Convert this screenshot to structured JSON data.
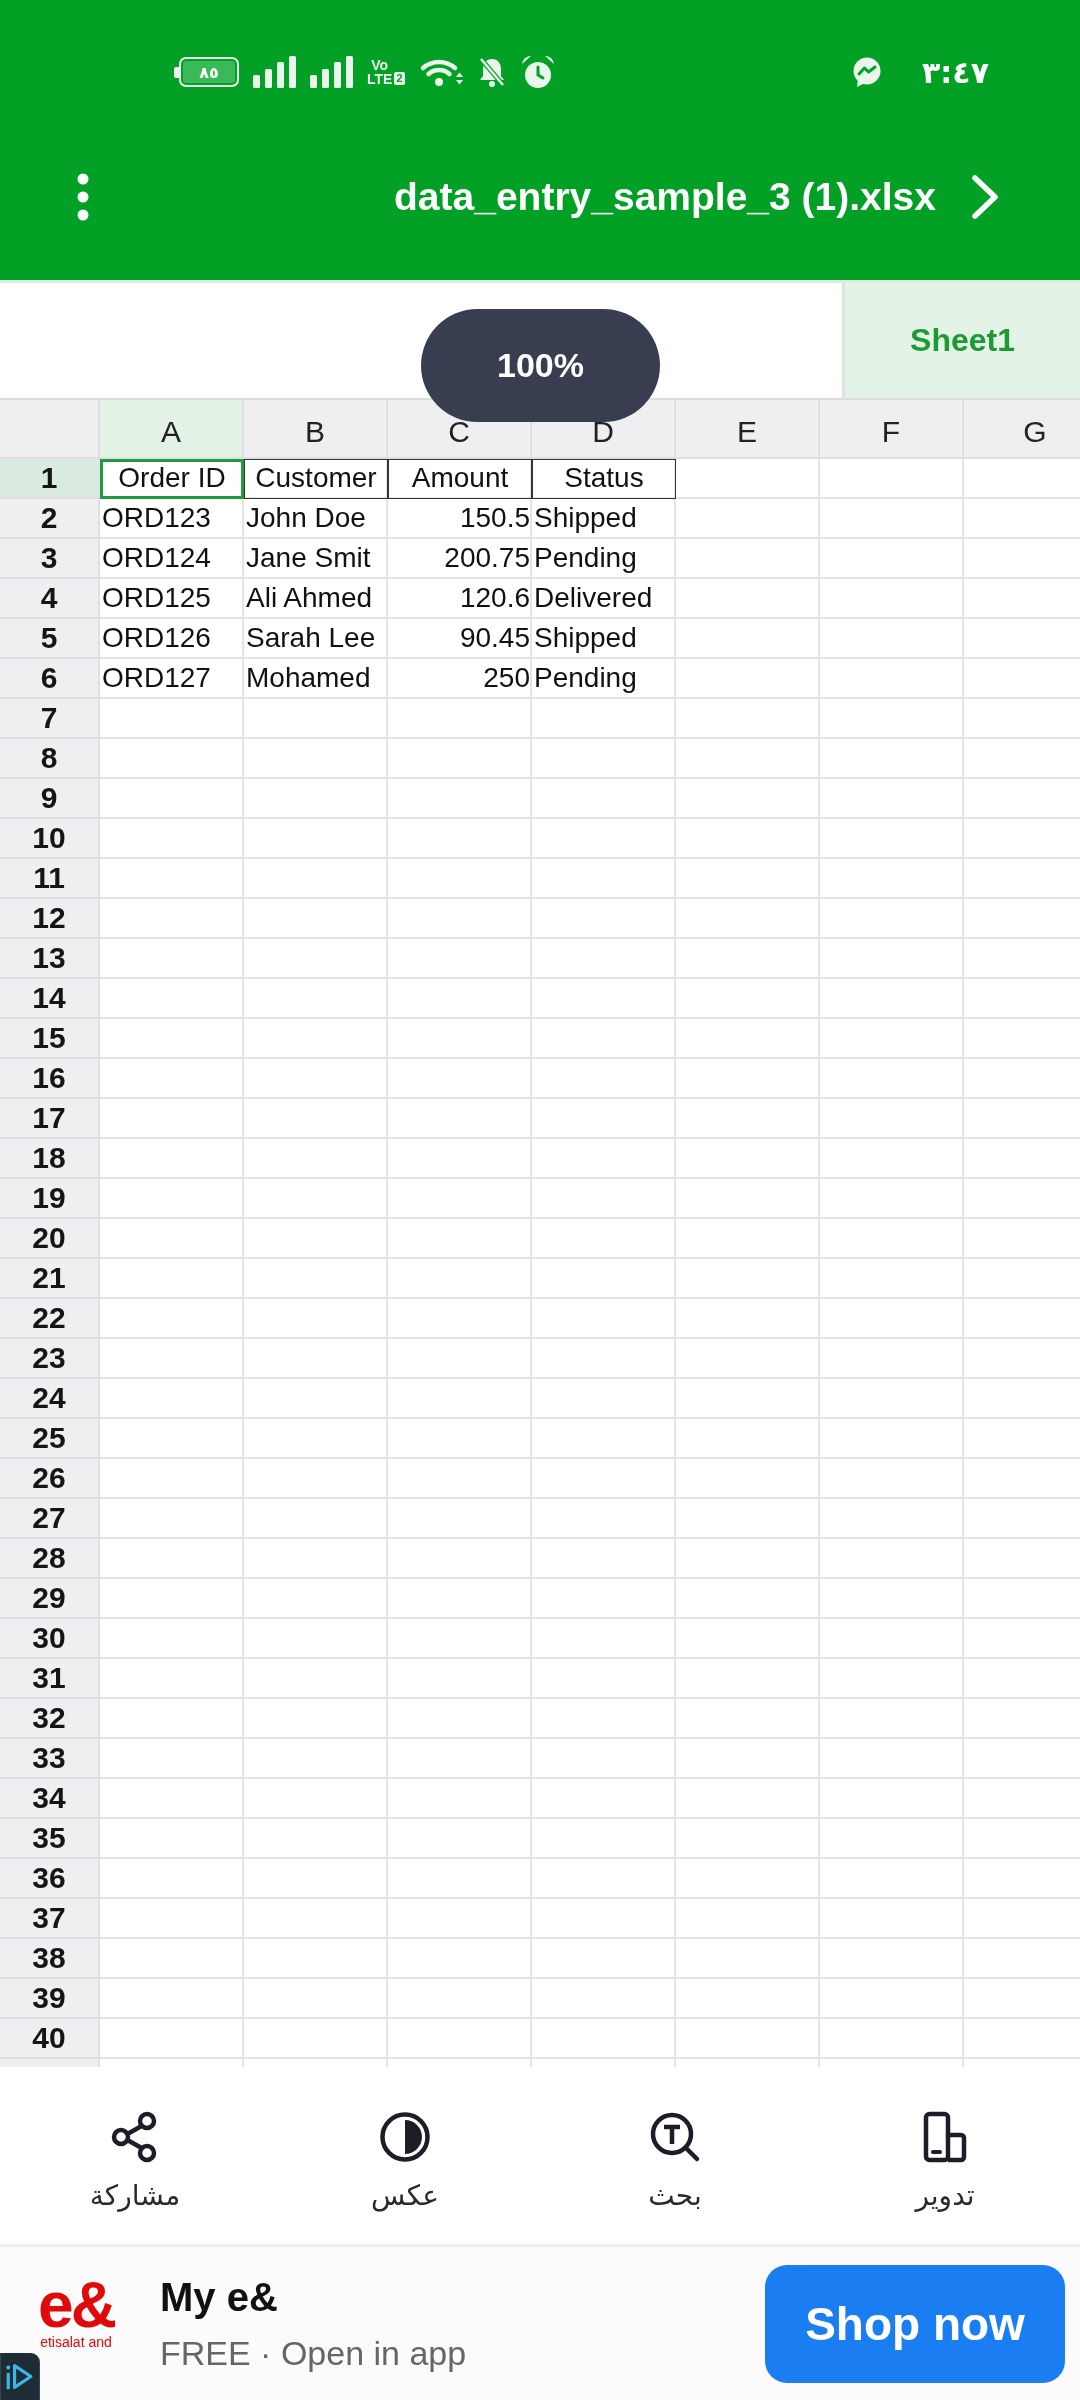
{
  "status_bar": {
    "battery": "٨٥",
    "network_type": "Vo LTE",
    "sim": "2",
    "time": "٣:٤٧"
  },
  "title_bar": {
    "title": "data_entry_sample_3 (1).xlsx"
  },
  "zoom_badge": "100%",
  "sheet_tabs": [
    {
      "label": "Sheet1",
      "selected": true
    }
  ],
  "sheet": {
    "columns": [
      {
        "label": "A",
        "selected": true
      },
      {
        "label": "B",
        "selected": false
      },
      {
        "label": "C",
        "selected": false
      },
      {
        "label": "D",
        "selected": false
      },
      {
        "label": "E",
        "selected": false
      },
      {
        "label": "F",
        "selected": false
      },
      {
        "label": "G",
        "selected": false
      }
    ],
    "rows": [
      {
        "number": "1",
        "selected": true,
        "cells": [
          {
            "text": "Order ID",
            "kind": "header",
            "selected": true
          },
          {
            "text": "Customer",
            "kind": "header",
            "selected": false
          },
          {
            "text": "Amount",
            "kind": "header",
            "selected": false
          },
          {
            "text": "Status",
            "kind": "header",
            "selected": false
          }
        ]
      },
      {
        "number": "2",
        "selected": false,
        "cells": [
          {
            "text": "ORD123",
            "kind": "text",
            "selected": false
          },
          {
            "text": "John Doe",
            "kind": "text",
            "selected": false
          },
          {
            "text": "150.5",
            "kind": "number",
            "selected": false
          },
          {
            "text": "Shipped",
            "kind": "text",
            "selected": false
          }
        ]
      },
      {
        "number": "3",
        "selected": false,
        "cells": [
          {
            "text": "ORD124",
            "kind": "text",
            "selected": false
          },
          {
            "text": "Jane Smit",
            "kind": "text",
            "selected": false
          },
          {
            "text": "200.75",
            "kind": "number",
            "selected": false
          },
          {
            "text": "Pending",
            "kind": "text",
            "selected": false
          }
        ]
      },
      {
        "number": "4",
        "selected": false,
        "cells": [
          {
            "text": "ORD125",
            "kind": "text",
            "selected": false
          },
          {
            "text": "Ali Ahmed",
            "kind": "text",
            "selected": false
          },
          {
            "text": "120.6",
            "kind": "number",
            "selected": false
          },
          {
            "text": "Delivered",
            "kind": "text",
            "selected": false
          }
        ]
      },
      {
        "number": "5",
        "selected": false,
        "cells": [
          {
            "text": "ORD126",
            "kind": "text",
            "selected": false
          },
          {
            "text": "Sarah Lee",
            "kind": "text",
            "selected": false
          },
          {
            "text": "90.45",
            "kind": "number",
            "selected": false
          },
          {
            "text": "Shipped",
            "kind": "text",
            "selected": false
          }
        ]
      },
      {
        "number": "6",
        "selected": false,
        "cells": [
          {
            "text": "ORD127",
            "kind": "text",
            "selected": false
          },
          {
            "text": "Mohamed",
            "kind": "text",
            "selected": false
          },
          {
            "text": "250",
            "kind": "number",
            "selected": false
          },
          {
            "text": "Pending",
            "kind": "text",
            "selected": false
          }
        ]
      },
      {
        "number": "7",
        "selected": false
      },
      {
        "number": "8",
        "selected": false
      },
      {
        "number": "9",
        "selected": false
      },
      {
        "number": "10",
        "selected": false
      },
      {
        "number": "11",
        "selected": false
      },
      {
        "number": "12",
        "selected": false
      },
      {
        "number": "13",
        "selected": false
      },
      {
        "number": "14",
        "selected": false
      },
      {
        "number": "15",
        "selected": false
      },
      {
        "number": "16",
        "selected": false
      },
      {
        "number": "17",
        "selected": false
      },
      {
        "number": "18",
        "selected": false
      },
      {
        "number": "19",
        "selected": false
      },
      {
        "number": "20",
        "selected": false
      },
      {
        "number": "21",
        "selected": false
      },
      {
        "number": "22",
        "selected": false
      },
      {
        "number": "23",
        "selected": false
      },
      {
        "number": "24",
        "selected": false
      },
      {
        "number": "25",
        "selected": false
      },
      {
        "number": "26",
        "selected": false
      },
      {
        "number": "27",
        "selected": false
      },
      {
        "number": "28",
        "selected": false
      },
      {
        "number": "29",
        "selected": false
      },
      {
        "number": "30",
        "selected": false
      },
      {
        "number": "31",
        "selected": false
      },
      {
        "number": "32",
        "selected": false
      },
      {
        "number": "33",
        "selected": false
      },
      {
        "number": "34",
        "selected": false
      },
      {
        "number": "35",
        "selected": false
      },
      {
        "number": "36",
        "selected": false
      },
      {
        "number": "37",
        "selected": false
      },
      {
        "number": "38",
        "selected": false
      },
      {
        "number": "39",
        "selected": false
      },
      {
        "number": "40",
        "selected": false
      }
    ]
  },
  "bottom_toolbar": [
    {
      "label": "تدوير",
      "kind": "rotate"
    },
    {
      "label": "بحث",
      "kind": "search"
    },
    {
      "label": "عكس",
      "kind": "invert"
    },
    {
      "label": "مشاركة",
      "kind": "share"
    }
  ],
  "ad": {
    "logo": "e&",
    "logo_caption": "etisalat and",
    "title": "My e&",
    "subtitle": "FREE · Open in app",
    "button": "Shop now"
  }
}
